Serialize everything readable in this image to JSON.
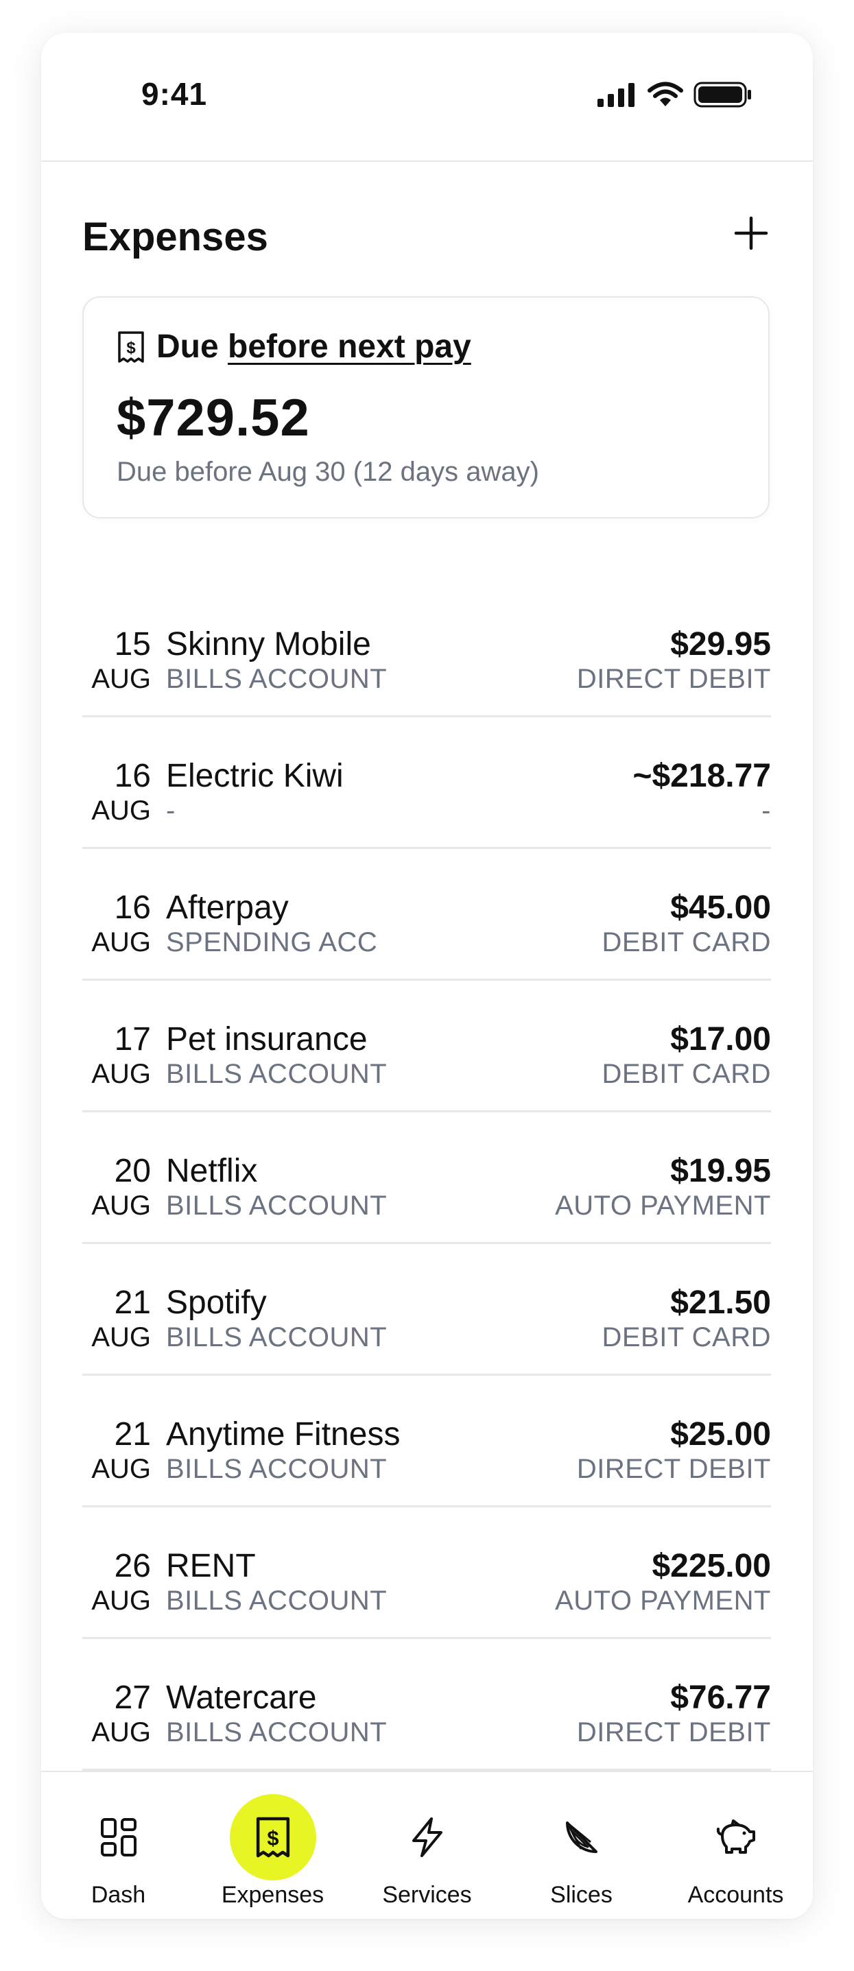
{
  "status": {
    "time": "9:41"
  },
  "header": {
    "title": "Expenses",
    "add_icon": "plus-icon"
  },
  "due_card": {
    "icon": "receipt-icon",
    "prefix": "Due",
    "link": "before next pay",
    "amount": "$729.52",
    "subtitle": "Due before Aug 30  (12 days away)"
  },
  "expenses": [
    {
      "day": "15",
      "month": "AUG",
      "name": "Skinny Mobile",
      "account": "BILLS ACCOUNT",
      "amount": "$29.95",
      "method": "DIRECT DEBIT"
    },
    {
      "day": "16",
      "month": "AUG",
      "name": "Electric Kiwi",
      "account": "-",
      "amount": "~$218.77",
      "method": "-"
    },
    {
      "day": "16",
      "month": "AUG",
      "name": "Afterpay",
      "account": "SPENDING ACC",
      "amount": "$45.00",
      "method": "DEBIT CARD"
    },
    {
      "day": "17",
      "month": "AUG",
      "name": "Pet insurance",
      "account": "BILLS ACCOUNT",
      "amount": "$17.00",
      "method": "DEBIT CARD"
    },
    {
      "day": "20",
      "month": "AUG",
      "name": "Netflix",
      "account": "BILLS ACCOUNT",
      "amount": "$19.95",
      "method": "AUTO PAYMENT"
    },
    {
      "day": "21",
      "month": "AUG",
      "name": "Spotify",
      "account": "BILLS ACCOUNT",
      "amount": "$21.50",
      "method": "DEBIT CARD"
    },
    {
      "day": "21",
      "month": "AUG",
      "name": "Anytime Fitness",
      "account": "BILLS ACCOUNT",
      "amount": "$25.00",
      "method": "DIRECT DEBIT"
    },
    {
      "day": "26",
      "month": "AUG",
      "name": "RENT",
      "account": "BILLS ACCOUNT",
      "amount": "$225.00",
      "method": "AUTO PAYMENT"
    },
    {
      "day": "27",
      "month": "AUG",
      "name": "Watercare",
      "account": "BILLS ACCOUNT",
      "amount": "$76.77",
      "method": "DIRECT DEBIT"
    }
  ],
  "tabs": [
    {
      "label": "Dash",
      "icon": "dashboard-grid-icon",
      "active": false
    },
    {
      "label": "Expenses",
      "icon": "receipt-icon",
      "active": true
    },
    {
      "label": "Services",
      "icon": "lightning-icon",
      "active": false
    },
    {
      "label": "Slices",
      "icon": "citrus-slice-icon",
      "active": false
    },
    {
      "label": "Accounts",
      "icon": "piggy-bank-icon",
      "active": false
    }
  ],
  "colors": {
    "accent": "#e8f524",
    "text": "#111111",
    "muted": "#6b7280",
    "divider": "#e5e7eb"
  }
}
